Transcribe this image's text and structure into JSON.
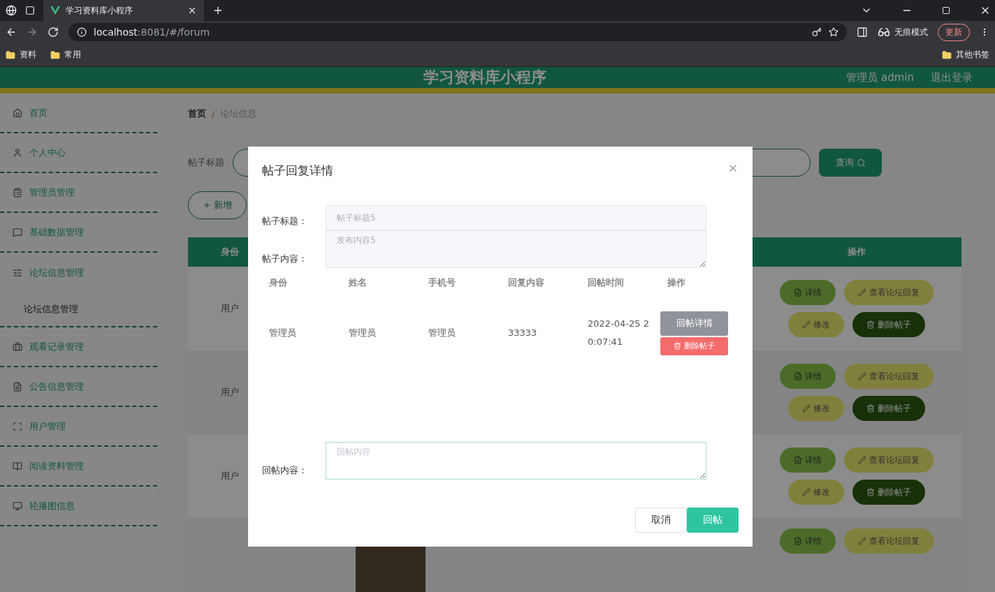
{
  "browser": {
    "tab_title": "学习资料库小程序",
    "url_host": "localhost",
    "url_rest": ":8081/#/forum",
    "incognito_label": "无痕模式",
    "update_label": "更新",
    "bookmarks": [
      "资料",
      "常用"
    ],
    "other_bookmarks": "其他书签"
  },
  "header": {
    "title": "学习资料库小程序",
    "user": "管理员 admin",
    "logout": "退出登录"
  },
  "sidebar": {
    "items": [
      {
        "label": "首页",
        "expanded": false
      },
      {
        "label": "个人中心",
        "expanded": false
      },
      {
        "label": "管理员管理",
        "expanded": false
      },
      {
        "label": "基础数据管理",
        "expanded": false
      },
      {
        "label": "论坛信息管理",
        "expanded": true,
        "children": [
          {
            "label": "论坛信息管理"
          }
        ]
      },
      {
        "label": "观看记录管理",
        "expanded": false
      },
      {
        "label": "公告信息管理",
        "expanded": false
      },
      {
        "label": "用户管理",
        "expanded": false
      },
      {
        "label": "阅读资料管理",
        "expanded": false
      },
      {
        "label": "轮播图信息",
        "expanded": false
      }
    ]
  },
  "breadcrumb": {
    "items": [
      "首页",
      "论坛信息"
    ],
    "separator": "/"
  },
  "search": {
    "label": "帖子标题",
    "button": "查询"
  },
  "add_button": "新增",
  "table": {
    "columns": [
      "身份",
      "操作"
    ],
    "rows": [
      {
        "role": "用户",
        "actions": [
          "详情",
          "查看论坛回复",
          "修改",
          "删除帖子"
        ]
      },
      {
        "role": "用户",
        "actions": [
          "详情",
          "查看论坛回复",
          "修改",
          "删除帖子"
        ]
      },
      {
        "role": "用户",
        "actions": [
          "详情",
          "查看论坛回复",
          "修改",
          "删除帖子"
        ]
      },
      {
        "actions": [
          "详情",
          "查看论坛回复"
        ]
      }
    ]
  },
  "modal": {
    "title": "帖子回复详情",
    "fields": [
      {
        "kind": "input",
        "label": "帖子标题：",
        "value": "帖子标题5"
      },
      {
        "kind": "textarea",
        "label": "帖子内容：",
        "value": "发布内容5"
      }
    ],
    "table": {
      "columns": [
        "身份",
        "姓名",
        "手机号",
        "回复内容",
        "回帖时间",
        "操作"
      ],
      "rows": [
        {
          "cells": [
            "管理员",
            "管理员",
            "管理员",
            "33333",
            "2022-04-25 20:07:41"
          ],
          "actions": [
            {
              "kind": "info",
              "label": "回帖详情"
            },
            {
              "kind": "danger",
              "label": "删除帖子"
            }
          ]
        }
      ]
    },
    "reply": {
      "label": "回帖内容：",
      "placeholder": "回帖内容"
    },
    "buttons": [
      {
        "kind": "default",
        "label": "取消"
      },
      {
        "kind": "primary",
        "label": "回帖"
      }
    ]
  }
}
